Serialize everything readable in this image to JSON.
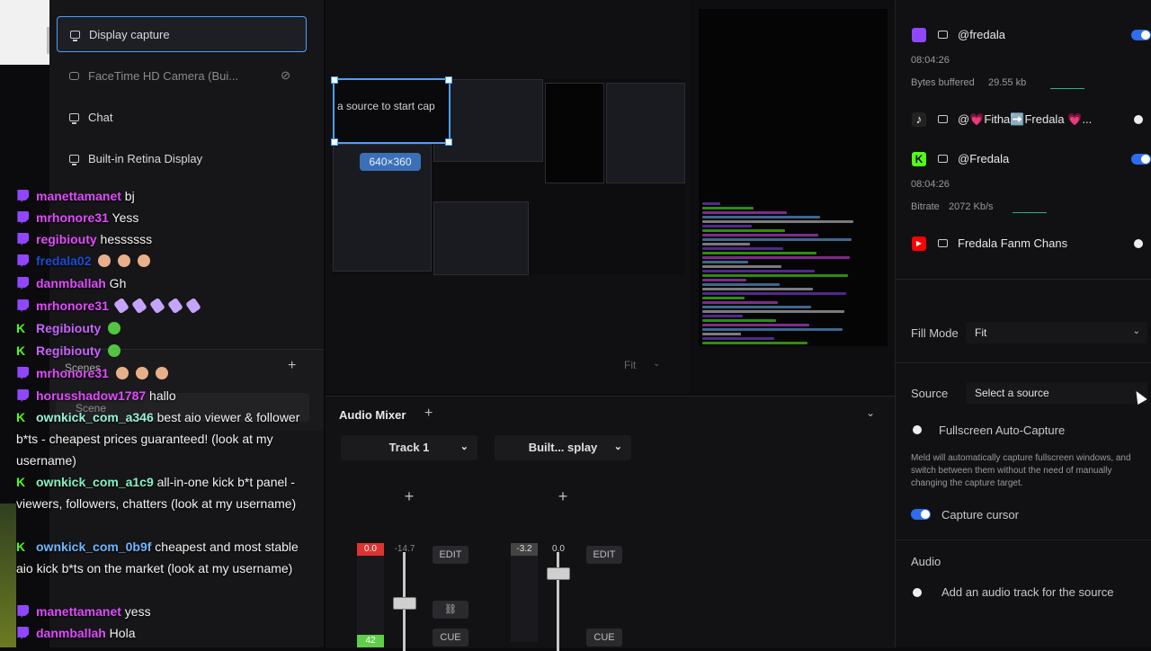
{
  "sources": {
    "items": [
      {
        "label": "Display capture",
        "icon": "monitor-icon",
        "active": true
      },
      {
        "label": "FaceTime HD Camera (Bui...",
        "icon": "camera-icon",
        "dim": true
      },
      {
        "label": "Chat",
        "icon": "monitor-icon"
      },
      {
        "label": "Built-in Retina Display",
        "icon": "monitor-icon"
      }
    ]
  },
  "scenes": {
    "title": "Scenes",
    "add": "+",
    "scene_name": "Scene"
  },
  "chat": [
    {
      "platform": "twitch",
      "user": "manettamanet",
      "color": "#e14bff",
      "msg": "bj"
    },
    {
      "platform": "twitch",
      "user": "mrhonore31",
      "color": "#e14bff",
      "msg": "Yess"
    },
    {
      "platform": "twitch",
      "user": "regibiouty",
      "color": "#e14bff",
      "msg": "hessssss"
    },
    {
      "platform": "twitch",
      "user": "fredala02",
      "color": "#1e4bd8",
      "msg": "",
      "emotes": 3
    },
    {
      "platform": "twitch",
      "user": "danmballah",
      "color": "#e14bff",
      "msg": "Gh"
    },
    {
      "platform": "twitch",
      "user": "mrhonore31",
      "color": "#e14bff",
      "msg": "",
      "emotes": 5
    },
    {
      "platform": "kick",
      "user": "Regibiouty",
      "color": "#c764ff",
      "msg": ""
    },
    {
      "platform": "kick",
      "user": "Regibiouty",
      "color": "#c764ff",
      "msg": ""
    },
    {
      "platform": "twitch",
      "user": "mrhonore31",
      "color": "#e14bff",
      "msg": "",
      "emotes": 3
    },
    {
      "platform": "twitch",
      "user": "horusshadow1787",
      "color": "#e14bff",
      "msg": "hallo"
    },
    {
      "platform": "kick",
      "user": "ownkick_com_a346",
      "color": "#9bf2d6",
      "msg": "best aio viewer & follower b*ts - cheapest prices guaranteed! (look at my username)"
    },
    {
      "platform": "kick",
      "user": "ownkick_com_a1c9",
      "color": "#86f0c0",
      "msg": "all-in-one kick b*t panel - viewers, followers, chatters (look at my username)"
    },
    {
      "platform": "kick",
      "user": "ownkick_com_0b9f",
      "color": "#6fb7ff",
      "msg": "cheapest and most stable aio kick b*ts on the market (look at my username)"
    },
    {
      "platform": "twitch",
      "user": "manettamanet",
      "color": "#e14bff",
      "msg": "yess"
    },
    {
      "platform": "twitch",
      "user": "danmballah",
      "color": "#e14bff",
      "msg": "Hola"
    }
  ],
  "canvas": {
    "selection_text": "a source to start cap",
    "size_badge": "640×360",
    "fit_label": "Fit"
  },
  "mixer": {
    "title": "Audio Mixer",
    "add": "+",
    "tracks": [
      {
        "name": "Track 1",
        "peak": "0.0",
        "level": "-14.7",
        "bottom": "42",
        "edit": "EDIT",
        "cue": "CUE",
        "fader": 0.55
      },
      {
        "name": "Built... splay",
        "peak": "-3.2",
        "level": "0.0",
        "edit": "EDIT",
        "cue": "CUE",
        "fader": 0.85
      }
    ]
  },
  "destinations": [
    {
      "platform": "twitch",
      "name": "@fredala",
      "time": "08:04:26",
      "stat_label": "Bytes buffered",
      "stat_value": "29.55 kb",
      "enabled": true
    },
    {
      "platform": "tiktok",
      "name": "@💗Fitha➡️Fredala 💗...",
      "enabled": false
    },
    {
      "platform": "kick",
      "name": "@Fredala",
      "time": "08:04:26",
      "stat_label": "Bitrate",
      "stat_value": "2072 Kb/s",
      "enabled": true
    },
    {
      "platform": "youtube",
      "name": "Fredala Fanm Chans",
      "enabled": false
    }
  ],
  "settings": {
    "fill_mode_label": "Fill Mode",
    "fill_mode_value": "Fit",
    "source_label": "Source",
    "source_placeholder": "Select a source",
    "fullscreen_label": "Fullscreen Auto-Capture",
    "help_text": "Meld will automatically capture fullscreen windows, and switch between them without the need of manually changing the capture target.",
    "capture_cursor_label": "Capture cursor",
    "audio_label": "Audio",
    "add_audio_label": "Add an audio track for the source"
  },
  "colors": {
    "accent": "#4aa0ff",
    "twitch": "#9146ff",
    "kick": "#53fc18",
    "youtube": "#ff0000",
    "toggle_on": "#2e6cf0"
  }
}
